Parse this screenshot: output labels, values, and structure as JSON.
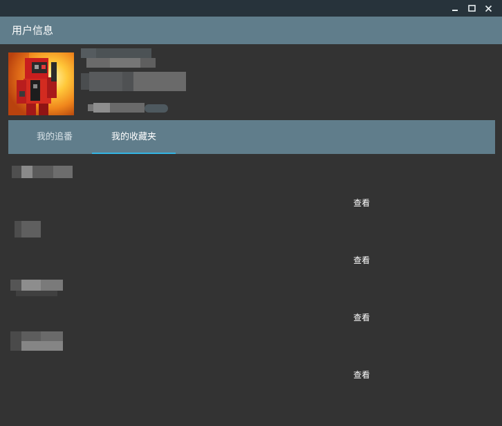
{
  "window": {
    "title": "用户信息",
    "controls": {
      "minimize_icon": "minimize-icon",
      "maximize_icon": "maximize-icon",
      "close_icon": "close-icon"
    }
  },
  "colors": {
    "chrome": "#27333b",
    "titlebar": "#607d8b",
    "background": "#333333",
    "tab_indicator": "#33b5e5"
  },
  "profile": {
    "avatar_alt": "avatar"
  },
  "tabs": [
    {
      "label": "我的追番",
      "active": false
    },
    {
      "label": "我的收藏夹",
      "active": true
    }
  ],
  "favorites": [
    {
      "action_label": "查看"
    },
    {
      "action_label": "查看"
    },
    {
      "action_label": "查看"
    },
    {
      "action_label": "查看"
    }
  ]
}
